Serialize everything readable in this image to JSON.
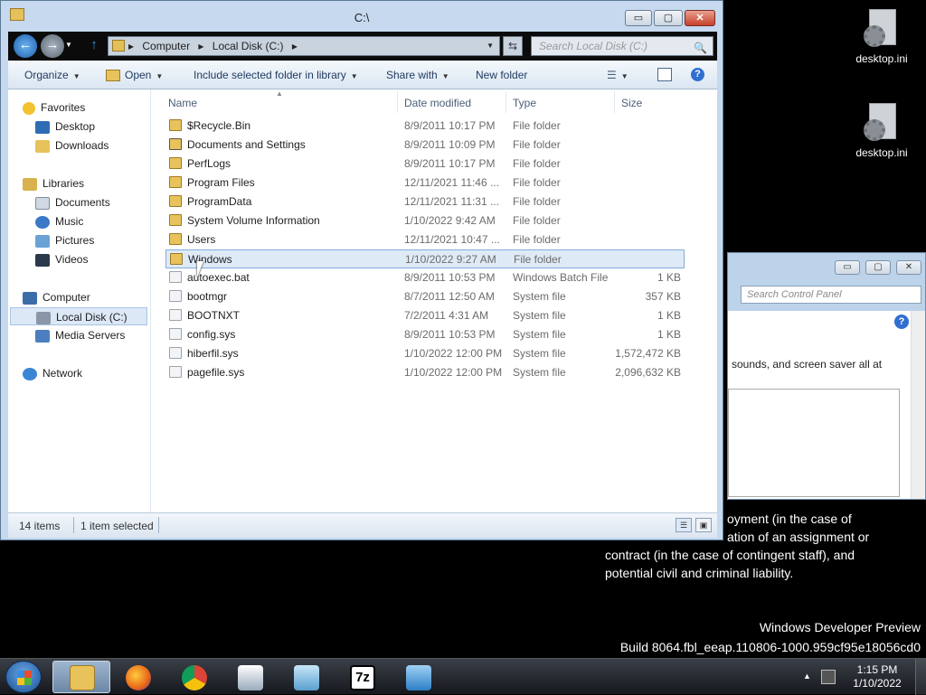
{
  "desktop": {
    "icons": [
      {
        "label": "desktop.ini"
      },
      {
        "label": "desktop.ini"
      }
    ],
    "message_lines": [
      "oyment (in the case of",
      "ation of an assignment or",
      "contract (in the case of contingent staff), and",
      "potential civil and criminal liability."
    ],
    "build_line1": "Windows Developer Preview",
    "build_line2": "Build 8064.fbl_eeap.110806-1000.959cf95e18056cd0"
  },
  "control_panel": {
    "search_placeholder": "Search Control Panel",
    "help_label": "?",
    "body_text": "sounds, and screen saver all at",
    "btn_min": "▭",
    "btn_max": "▢",
    "btn_close": "✕"
  },
  "explorer": {
    "title": "C:\\",
    "window_buttons": {
      "minimize": "▭",
      "maximize": "▢",
      "close": "✕"
    },
    "breadcrumb": [
      "Computer",
      "Local Disk (C:)"
    ],
    "search_placeholder": "Search Local Disk (C:)",
    "toolbar": {
      "organize": "Organize",
      "open": "Open",
      "include": "Include selected folder in library",
      "share": "Share with",
      "new_folder": "New folder",
      "help": "?"
    },
    "nav": {
      "favorites": "Favorites",
      "desktop": "Desktop",
      "downloads": "Downloads",
      "libraries": "Libraries",
      "documents": "Documents",
      "music": "Music",
      "pictures": "Pictures",
      "videos": "Videos",
      "computer": "Computer",
      "local_disk": "Local Disk (C:)",
      "media_servers": "Media Servers",
      "network": "Network"
    },
    "columns": {
      "name": "Name",
      "date": "Date modified",
      "type": "Type",
      "size": "Size"
    },
    "files": [
      {
        "name": "$Recycle.Bin",
        "date": "8/9/2011 10:17 PM",
        "type": "File folder",
        "size": "",
        "kind": "folder"
      },
      {
        "name": "Documents and Settings",
        "date": "8/9/2011 10:09 PM",
        "type": "File folder",
        "size": "",
        "kind": "link"
      },
      {
        "name": "PerfLogs",
        "date": "8/9/2011 10:17 PM",
        "type": "File folder",
        "size": "",
        "kind": "folder"
      },
      {
        "name": "Program Files",
        "date": "12/11/2021 11:46 ...",
        "type": "File folder",
        "size": "",
        "kind": "folder"
      },
      {
        "name": "ProgramData",
        "date": "12/11/2021 11:31 ...",
        "type": "File folder",
        "size": "",
        "kind": "folder"
      },
      {
        "name": "System Volume Information",
        "date": "1/10/2022 9:42 AM",
        "type": "File folder",
        "size": "",
        "kind": "folder"
      },
      {
        "name": "Users",
        "date": "12/11/2021 10:47 ...",
        "type": "File folder",
        "size": "",
        "kind": "folder"
      },
      {
        "name": "Windows",
        "date": "1/10/2022 9:27 AM",
        "type": "File folder",
        "size": "",
        "kind": "folder"
      },
      {
        "name": "autoexec.bat",
        "date": "8/9/2011 10:53 PM",
        "type": "Windows Batch File",
        "size": "1 KB",
        "kind": "file"
      },
      {
        "name": "bootmgr",
        "date": "8/7/2011 12:50 AM",
        "type": "System file",
        "size": "357 KB",
        "kind": "file"
      },
      {
        "name": "BOOTNXT",
        "date": "7/2/2011 4:31 AM",
        "type": "System file",
        "size": "1 KB",
        "kind": "file"
      },
      {
        "name": "config.sys",
        "date": "8/9/2011 10:53 PM",
        "type": "System file",
        "size": "1 KB",
        "kind": "file"
      },
      {
        "name": "hiberfil.sys",
        "date": "1/10/2022 12:00 PM",
        "type": "System file",
        "size": "1,572,472 KB",
        "kind": "file"
      },
      {
        "name": "pagefile.sys",
        "date": "1/10/2022 12:00 PM",
        "type": "System file",
        "size": "2,096,632 KB",
        "kind": "file"
      }
    ],
    "selected_index": 7,
    "status": {
      "items": "14 items",
      "selected": "1 item selected"
    }
  },
  "taskbar": {
    "apps": [
      {
        "name": "windows-explorer",
        "icon": "folder-icon",
        "active": true
      },
      {
        "name": "firefox",
        "icon": "firefox-icon",
        "active": false
      },
      {
        "name": "chrome",
        "icon": "chrome-icon",
        "active": false
      },
      {
        "name": "control-panel",
        "icon": "control-panel-icon",
        "active": false
      },
      {
        "name": "notepad",
        "icon": "notepad-icon",
        "active": false
      },
      {
        "name": "7-zip",
        "icon": "7zip-icon",
        "active": false
      },
      {
        "name": "remote-desktop",
        "icon": "remote-desktop-icon",
        "active": false
      }
    ],
    "label_7z": "7z",
    "time": "1:15 PM",
    "date": "1/10/2022"
  },
  "colors": {
    "folder": "#e8c25a",
    "selection": "#dfeaf7",
    "accent": "#1e3a5f"
  }
}
